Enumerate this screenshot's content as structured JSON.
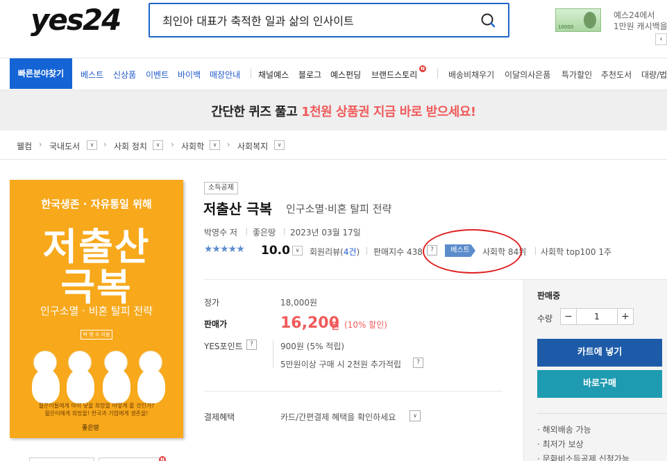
{
  "header": {
    "logo": "yes24",
    "search_value": "최인아 대표가 축적한 일과 삶의 인사이트",
    "promo_line1": "예스24에서",
    "promo_line2": "1만원 캐시백을?!",
    "promo_money": "10000",
    "prev_arrow": "‹"
  },
  "nav": {
    "category_button": "빠른분야찾기",
    "blue_items": [
      "베스트",
      "신상품",
      "이벤트",
      "바이백",
      "매장안내"
    ],
    "dark_items": [
      "채널예스",
      "블로그",
      "예스펀딩",
      "브랜드스토리"
    ],
    "new_badge": "N",
    "right_items": [
      "배송비채우기",
      "이달의사은품",
      "특가할인",
      "추천도서",
      "대량/법"
    ]
  },
  "banner": {
    "text_plain": "간단한 퀴즈 풀고 ",
    "text_highlight": "1천원 상품권 지금 바로 받으세요!"
  },
  "breadcrumb": [
    "웰컴",
    "국내도서",
    "사회 정치",
    "사회학",
    "사회복지"
  ],
  "cover": {
    "line1": "한국생존 · 자유통일 위해",
    "big1": "저출산",
    "big2": "극복",
    "sub": "인구소멸 · 비혼 탈피 전략",
    "author": "박 영 수  지음",
    "bottom1": "젊은이들에게 아이 낳을 희망을 어떻게 줄 것인가?",
    "bottom2": "젊은이에게 희망을! 한국과 기업에게 생존을!",
    "publisher": "좋은땅"
  },
  "book": {
    "tag": "소득공제",
    "title": "저출산 극복",
    "subtitle": "인구소멸·비혼 탈피 전략",
    "author": "박영수 저",
    "publisher": "좋은땅",
    "date": "2023년 03월 17일",
    "stars": "★★★★★",
    "rating": "10.0",
    "review_label": "회원리뷰(",
    "review_count": "4건",
    "review_close": ")",
    "sales_index": "판매지수 438",
    "help": "?",
    "best_label": "베스트",
    "rank1": "사회학 84위",
    "rank2": "사회학 top100 1주"
  },
  "price": {
    "list_label": "정가",
    "list_value": "18,000원",
    "sale_label": "판매가",
    "sale_value": "16,200",
    "sale_unit": "원",
    "sale_discount": "(10% 할인)",
    "points_label": "YES포인트",
    "points_value": "900원 (5% 적립)",
    "points_extra": "5만원이상 구매 시 2천원 추가적립",
    "benefit_label": "결제혜택",
    "benefit_value": "카드/간편결제 혜택을 확인하세요"
  },
  "buy": {
    "status": "판매중",
    "qty_label": "수량",
    "minus": "−",
    "plus": "+",
    "qty_value": "1",
    "cart": "카트에 넣기",
    "buy_now": "바로구매",
    "notes": [
      "· 해외배송 가능",
      "· 최저가 보상",
      "· 문화비소득공제 신청가능"
    ]
  }
}
